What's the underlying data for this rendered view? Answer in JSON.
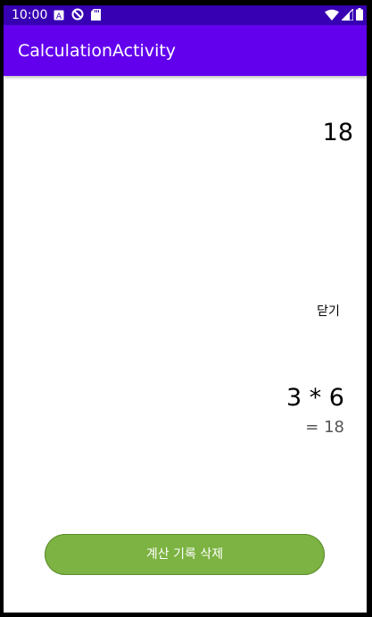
{
  "status_bar": {
    "time": "10:00",
    "left_icons": [
      "a-box-icon",
      "no-disturb-icon",
      "sd-card-icon"
    ],
    "right_icons": [
      "wifi-icon",
      "signal-icon",
      "battery-icon"
    ],
    "background_color": "#3700b3"
  },
  "app_bar": {
    "title": "CalculationActivity",
    "background_color": "#6200ee"
  },
  "display": {
    "result": "18"
  },
  "close_button": {
    "label": "닫기"
  },
  "history": [
    {
      "expression": "3 * 6",
      "result": "= 18"
    }
  ],
  "delete_button": {
    "label": "계산 기록 삭제",
    "color": "#7cb342"
  }
}
